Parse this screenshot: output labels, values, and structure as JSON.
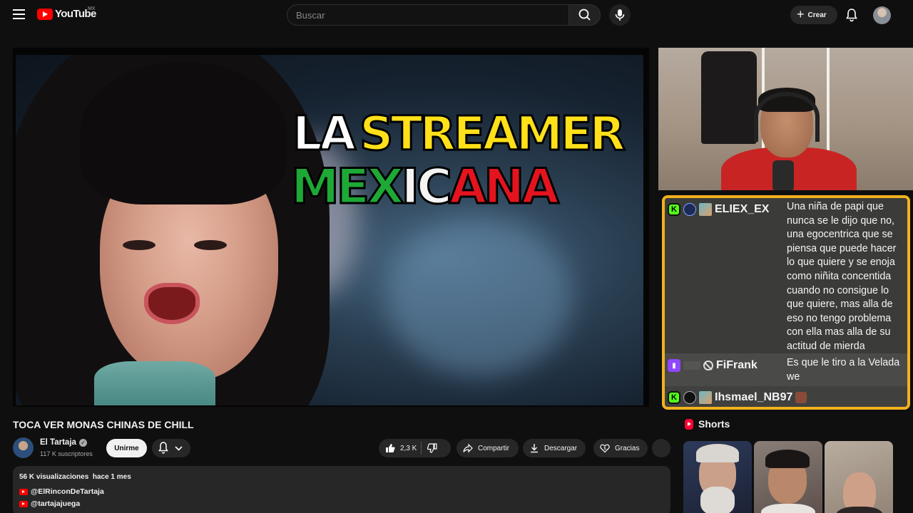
{
  "header": {
    "logo_text": "YouTube",
    "country": "MX",
    "search_placeholder": "Buscar",
    "create_label": "Crear"
  },
  "thumbnail": {
    "line1_a": "LA",
    "line1_b": "STREAMER",
    "line2_green": "MEX",
    "line2_white": "IC",
    "line2_red": "ANA"
  },
  "chat": {
    "messages": [
      {
        "user": "ELIEX_EX",
        "platform": "kick",
        "text": "Una niña de papi que nunca se le dijo que no, una egocentrica que se piensa que puede hacer lo que quiere y se enoja como niñita concentida cuando no consigue lo que quiere, mas alla de eso no tengo problema con ella mas alla de su actitud de mierda"
      },
      {
        "user": "FiFrank",
        "platform": "twitch",
        "text": "Es que le tiro a la Velada we"
      },
      {
        "user": "Ihsmael_NB97",
        "platform": "kick",
        "text": ""
      }
    ],
    "colors": {
      "border": "#f2b21d",
      "kick": "#53fc18",
      "twitch": "#9146ff"
    }
  },
  "video": {
    "title": "TOCA VER MONAS CHINAS DE CHILL",
    "channel": "El Tartaja",
    "subscribers": "117 K suscriptores",
    "join_label": "Unirme",
    "likes": "2,3 K",
    "share_label": "Compartir",
    "download_label": "Descargar",
    "thanks_label": "Gracias"
  },
  "description": {
    "views": "56 K visualizaciones",
    "date": "hace 1 mes",
    "links": [
      "@ElRinconDeTartaja",
      "@tartajajuega"
    ]
  },
  "shorts": {
    "title": "Shorts"
  }
}
